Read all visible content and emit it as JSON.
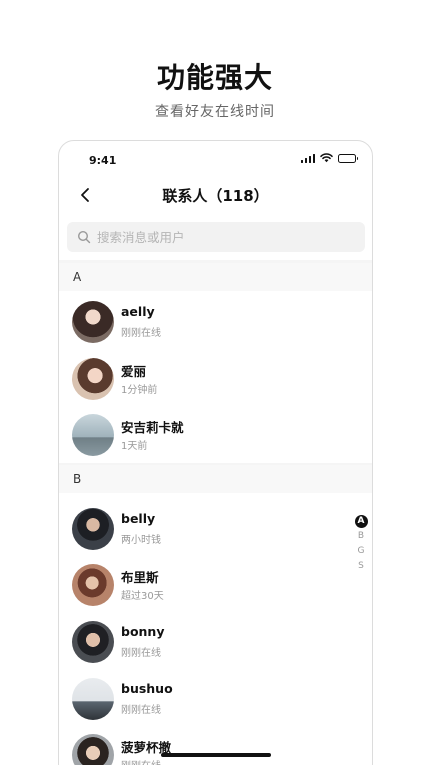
{
  "promo": {
    "title": "功能强大",
    "subtitle": "查看好友在线时间"
  },
  "status_bar": {
    "time": "9:41"
  },
  "nav": {
    "title": "联系人（118）"
  },
  "search": {
    "placeholder": "搜索消息或用户"
  },
  "sections": [
    {
      "letter": "A",
      "contacts": [
        {
          "name": "aelly",
          "status": "刚刚在线"
        },
        {
          "name": "爱丽",
          "status": "1分钟前"
        },
        {
          "name": "安吉莉卡就",
          "status": "1天前"
        }
      ]
    },
    {
      "letter": "B",
      "contacts": [
        {
          "name": "belly",
          "status": "两小时钱"
        },
        {
          "name": "布里斯",
          "status": "超过30天"
        },
        {
          "name": "bonny",
          "status": "刚刚在线"
        },
        {
          "name": "bushuo",
          "status": "刚刚在线"
        },
        {
          "name": "菠萝杯撤",
          "status": "刚刚在线"
        }
      ]
    }
  ],
  "index_bar": {
    "letters": [
      "A",
      "B",
      "G",
      "S"
    ],
    "active": "A"
  },
  "colors": {
    "accent": "#111111",
    "muted_text": "#999999",
    "search_bg": "#f2f2f2"
  }
}
